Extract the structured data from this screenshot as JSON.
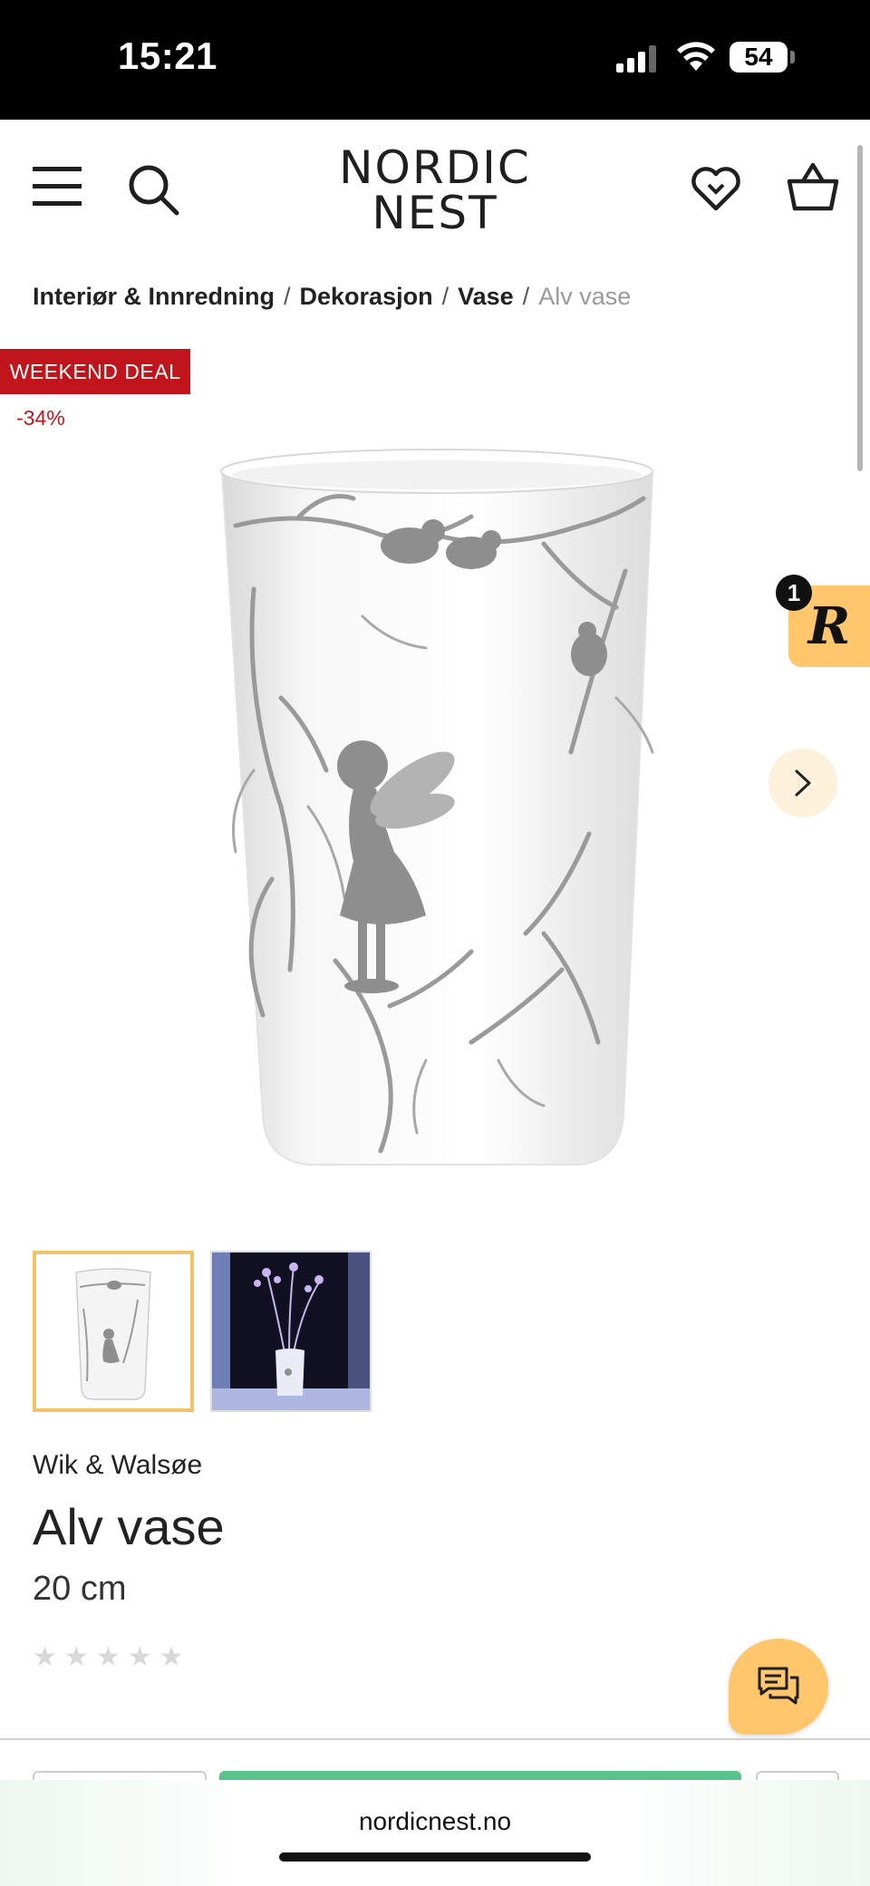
{
  "status_bar": {
    "time": "15:21",
    "battery": "54"
  },
  "header": {
    "logo_line1": "NORDIC",
    "logo_line2": "NEST"
  },
  "breadcrumb": {
    "items": [
      "Interiør & Innredning",
      "Dekorasjon",
      "Vase"
    ],
    "current": "Alv vase",
    "separator": "/"
  },
  "badges": {
    "deal": "WEEKEND DEAL",
    "discount": "-34%"
  },
  "reward": {
    "count": "1",
    "letter": "R"
  },
  "product": {
    "brand": "Wik & Walsøe",
    "title": "Alv vase",
    "size": "20 cm",
    "rating_stars": 0,
    "max_stars": 5
  },
  "browser": {
    "url": "nordicnest.no"
  },
  "colors": {
    "deal_red": "#c0151a",
    "accent_yellow": "#ffc66b",
    "buy_green": "#57c28a",
    "thumb_selected": "#f0c56a"
  },
  "icons": [
    "menu-icon",
    "search-icon",
    "heart-icon",
    "basket-icon",
    "chevron-right-icon",
    "chat-icon",
    "star-icon"
  ]
}
